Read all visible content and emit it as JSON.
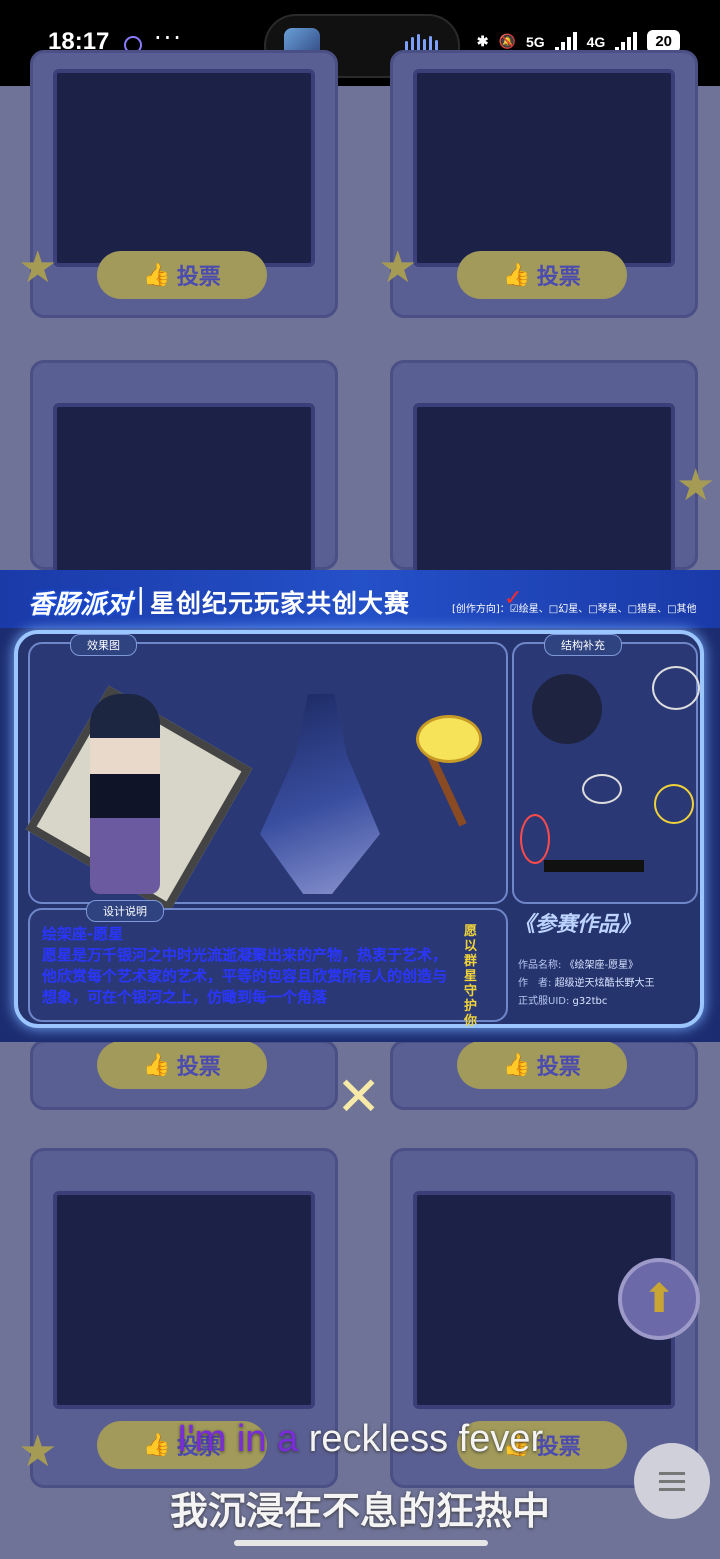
{
  "status_bar": {
    "time": "18:17",
    "dots": "···",
    "net1": "5G",
    "net2": "4G",
    "battery": "20"
  },
  "grid": {
    "vote_label": "投票"
  },
  "entry": {
    "brand": "香肠派对",
    "banner_title": "星创纪元玩家共创大赛",
    "direction": "[创作方向]：☑绘星、□幻星、□琴星、□猎星、□其他",
    "tab_effect": "效果图",
    "tab_structure": "结构补充",
    "tab_design": "设计说明",
    "design_title": "绘架座-愿星",
    "design_body": "愿星是万千银河之中时光流逝凝聚出来的产物，热衷于艺术，他欣赏每个艺术家的艺术，平等的包容且欣赏所有人的创造与想象，可在个银河之上，仿瞰到每一个角落",
    "vertical_text": "愿以群星守护你",
    "entry_heading": "《参赛作品》",
    "name_label": "作品名称:",
    "name_value": "《绘架座-愿星》",
    "author_label": "作　者:",
    "author_value": "超级逆天炫酷长野大王",
    "uid_label": "正式服UID:",
    "uid_value": "g32tbc"
  },
  "close_icon": "close-icon",
  "lyrics": {
    "line1_highlight": "I'm in a",
    "line1_rest": " reckless fever",
    "line2": "我沉浸在不息的狂热中"
  }
}
